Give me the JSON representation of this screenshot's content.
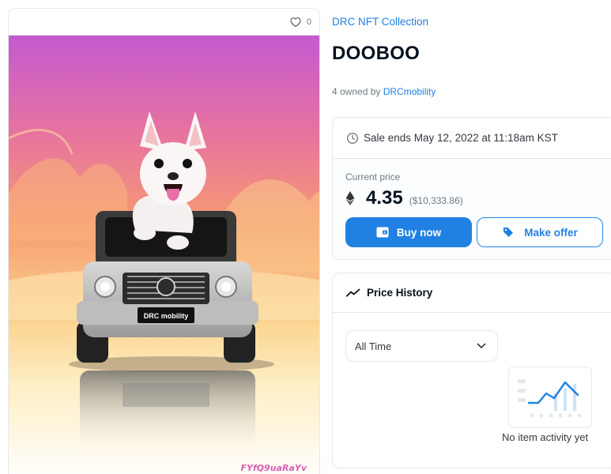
{
  "media": {
    "favorite_count": "0",
    "watermark": "FYfQ9uaRaYv",
    "plate_text": "DRC mobility"
  },
  "item": {
    "collection": "DRC NFT Collection",
    "title": "DOOBOO",
    "owned_prefix": "4 owned by ",
    "owner": "DRCmobility"
  },
  "sale": {
    "ends_text": "Sale ends May 12, 2022 at 11:18am KST",
    "price_label": "Current price",
    "price": "4.35",
    "price_usd": "($10,333.86)",
    "buy_label": "Buy now",
    "offer_label": "Make offer"
  },
  "history": {
    "title": "Price History",
    "range_selected": "All Time",
    "empty_text": "No item activity yet"
  },
  "colors": {
    "accent": "#2081e2",
    "text": "#04111d",
    "muted": "#707a83",
    "border": "#e5e8eb"
  }
}
